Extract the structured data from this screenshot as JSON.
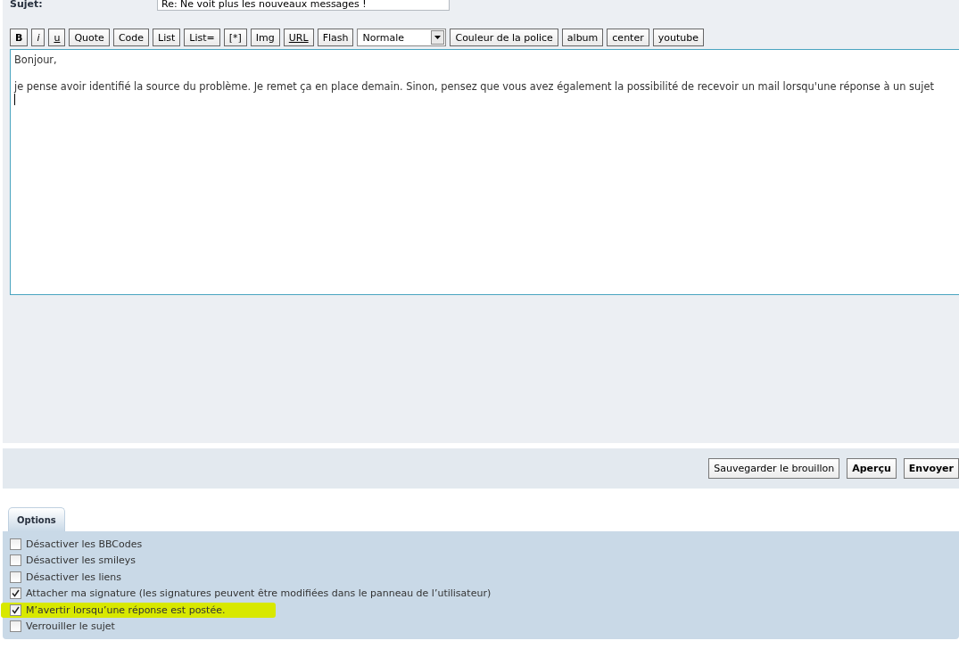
{
  "subject": {
    "label": "Sujet:",
    "value": "Re: Ne voit plus les nouveaux messages !"
  },
  "toolbar": [
    {
      "label": "B",
      "kind": "bold"
    },
    {
      "label": "i",
      "kind": "italic"
    },
    {
      "label": "u",
      "kind": "underline"
    },
    {
      "label": "Quote",
      "kind": "plain"
    },
    {
      "label": "Code",
      "kind": "plain"
    },
    {
      "label": "List",
      "kind": "plain"
    },
    {
      "label": "List=",
      "kind": "plain"
    },
    {
      "label": "[*]",
      "kind": "plain"
    },
    {
      "label": "Img",
      "kind": "plain"
    },
    {
      "label": "URL",
      "kind": "underline"
    },
    {
      "label": "Flash",
      "kind": "plain"
    },
    {
      "label": "Normale",
      "kind": "select"
    },
    {
      "label": "Couleur de la police",
      "kind": "plain"
    },
    {
      "label": "album",
      "kind": "plain"
    },
    {
      "label": "center",
      "kind": "plain"
    },
    {
      "label": "youtube",
      "kind": "plain"
    }
  ],
  "message": [
    "Bonjour,",
    "je pense avoir identifié la source du problème. Je remet ça en place demain. Sinon, pensez que vous avez également la possibilité de recevoir un mail lorsqu'une réponse à un sujet"
  ],
  "actions": [
    {
      "label": "Sauvegarder le brouillon",
      "primary": false
    },
    {
      "label": "Aperçu",
      "primary": true
    },
    {
      "label": "Envoyer",
      "primary": true
    }
  ],
  "options_tab": {
    "label": "Options",
    "selected": true
  },
  "options": [
    {
      "label": "Désactiver les BBCodes",
      "checked": false,
      "highlighted": false
    },
    {
      "label": "Désactiver les smileys",
      "checked": false,
      "highlighted": false
    },
    {
      "label": "Désactiver les liens",
      "checked": false,
      "highlighted": false
    },
    {
      "label": "Attacher ma signature (les signatures peuvent être modifiées dans le panneau de l’utilisateur)",
      "checked": true,
      "highlighted": false
    },
    {
      "label": "M’avertir lorsqu’une réponse est postée.",
      "checked": true,
      "highlighted": true
    },
    {
      "label": "Verrouiller le sujet",
      "checked": false,
      "highlighted": false
    }
  ]
}
